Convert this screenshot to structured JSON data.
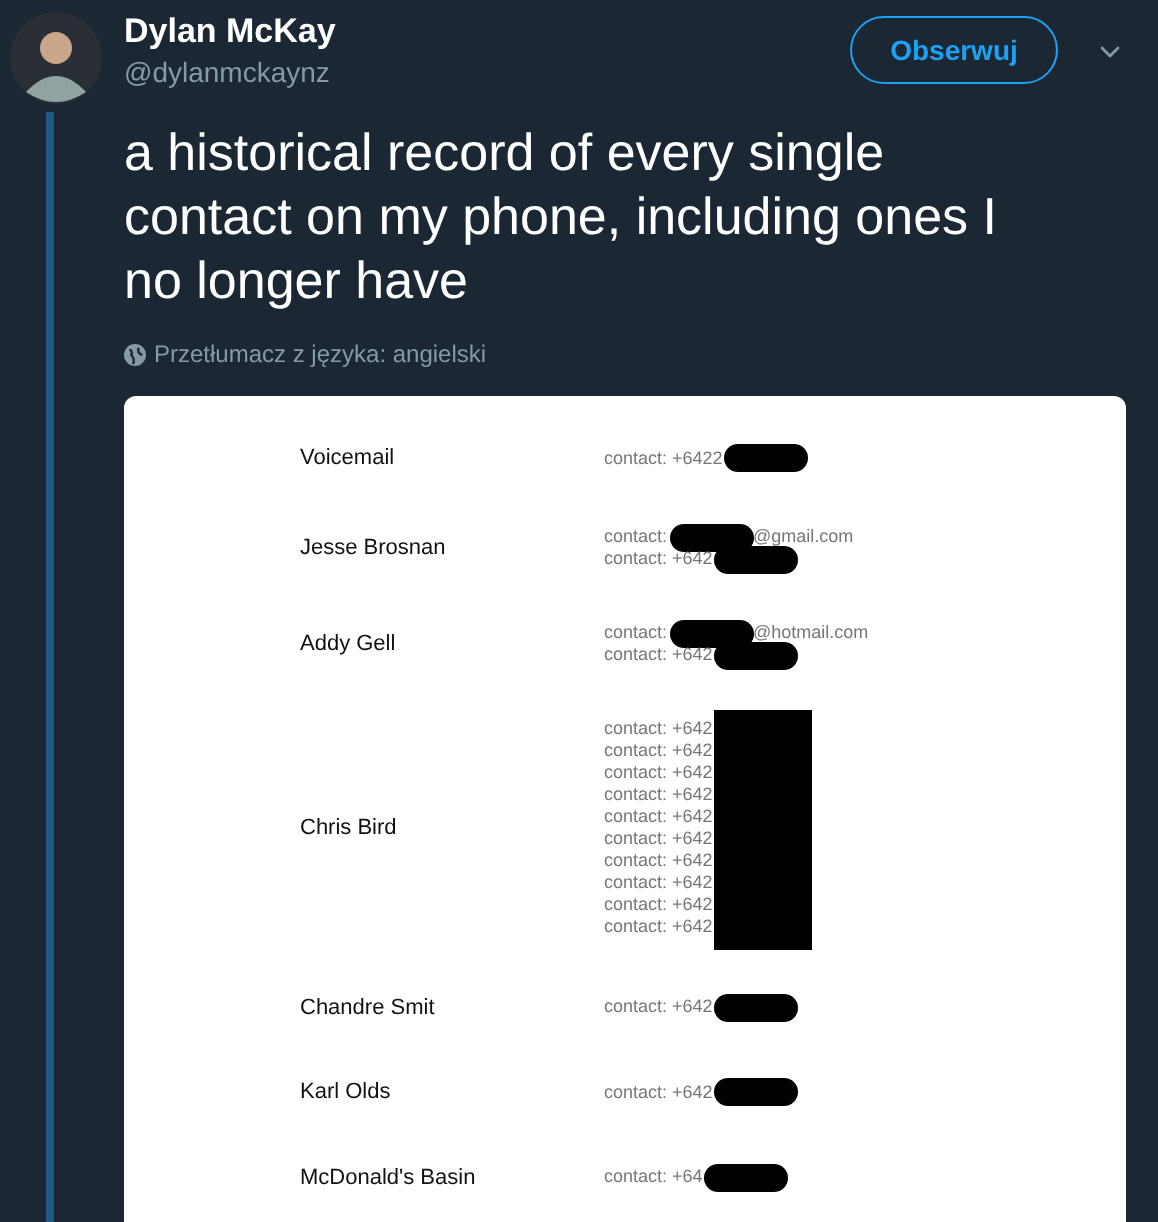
{
  "author": {
    "name": "Dylan McKay",
    "handle": "@dylanmckaynz"
  },
  "follow_button": "Obserwuj",
  "tweet_text": "a historical record of every single contact on my phone, including ones I no longer have",
  "translate": "Przetłumacz z języka: angielski",
  "contacts": [
    {
      "name": "Voicemail",
      "kind": "pill",
      "lines": [
        {
          "text": "contact: +6422"
        }
      ]
    },
    {
      "name": "Jesse Brosnan",
      "kind": "pill",
      "lines": [
        {
          "text": "contact:",
          "suffix": "@gmail.com"
        },
        {
          "text": "contact: +642"
        }
      ]
    },
    {
      "name": "Addy Gell",
      "kind": "pill",
      "lines": [
        {
          "text": "contact:",
          "suffix": "@hotmail.com"
        },
        {
          "text": "contact: +642"
        }
      ]
    },
    {
      "name": "Chris Bird",
      "kind": "block",
      "lines": [
        {
          "text": "contact: +642"
        },
        {
          "text": "contact: +642"
        },
        {
          "text": "contact: +642"
        },
        {
          "text": "contact: +642"
        },
        {
          "text": "contact: +642"
        },
        {
          "text": "contact: +642"
        },
        {
          "text": "contact: +642"
        },
        {
          "text": "contact: +642"
        },
        {
          "text": "contact: +642"
        },
        {
          "text": "contact: +642"
        }
      ]
    },
    {
      "name": "Chandre Smit",
      "kind": "pill",
      "lines": [
        {
          "text": "contact: +642"
        }
      ]
    },
    {
      "name": "Karl Olds",
      "kind": "pill",
      "lines": [
        {
          "text": "contact: +642"
        }
      ]
    },
    {
      "name": "McDonald's Basin",
      "kind": "pill",
      "lines": [
        {
          "text": "contact: +64"
        }
      ]
    }
  ]
}
